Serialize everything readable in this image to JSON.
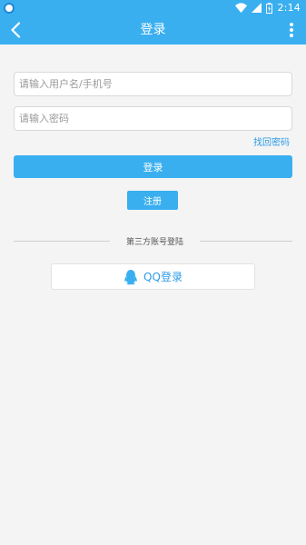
{
  "status_bar": {
    "time": "2:14",
    "icons": [
      "app-icon",
      "wifi-icon",
      "signal-icon",
      "battery-icon"
    ]
  },
  "app_bar": {
    "title": "登录",
    "back_icon": "chevron-left-icon",
    "menu_icon": "more-vertical-icon"
  },
  "form": {
    "username_placeholder": "请输入用户名/手机号",
    "username_value": "",
    "password_placeholder": "请输入密码",
    "password_value": "",
    "forgot_password": "找回密码",
    "login_button": "登录",
    "register_button": "注册"
  },
  "third_party": {
    "label": "第三方账号登陆",
    "qq_login": "QQ登录",
    "qq_icon": "qq-penguin-icon"
  },
  "colors": {
    "primary": "#3aaff0",
    "link": "#2d9be6",
    "background": "#f4f4f4"
  }
}
